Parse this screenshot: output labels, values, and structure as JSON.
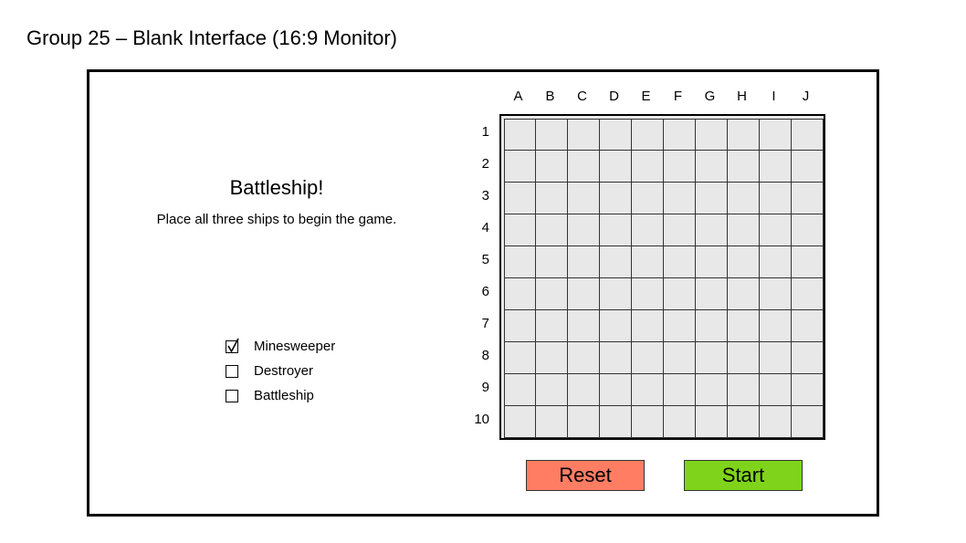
{
  "page": {
    "title": "Group 25 – Blank Interface (16:9 Monitor)"
  },
  "game": {
    "title": "Battleship!",
    "instructions": "Place all three ships to begin the game."
  },
  "ships": [
    {
      "label": "Minesweeper",
      "checked": true
    },
    {
      "label": "Destroyer",
      "checked": false
    },
    {
      "label": "Battleship",
      "checked": false
    }
  ],
  "board": {
    "columns": [
      "A",
      "B",
      "C",
      "D",
      "E",
      "F",
      "G",
      "H",
      "I",
      "J"
    ],
    "rows": [
      "1",
      "2",
      "3",
      "4",
      "5",
      "6",
      "7",
      "8",
      "9",
      "10"
    ],
    "cell_color": "#e8e8e8"
  },
  "buttons": {
    "reset": {
      "label": "Reset",
      "color": "#ff7d63"
    },
    "start": {
      "label": "Start",
      "color": "#7fd41b"
    }
  }
}
